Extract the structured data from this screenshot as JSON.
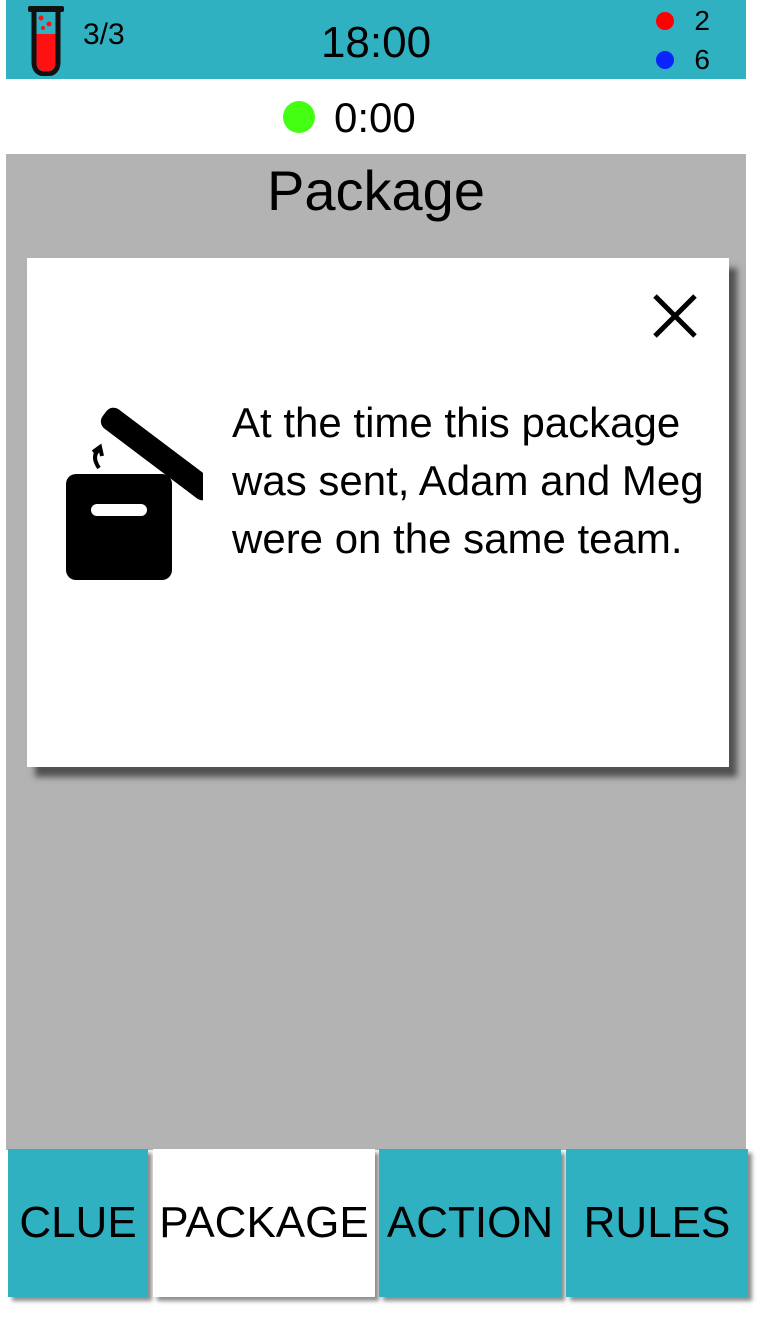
{
  "header": {
    "lives": "3/3",
    "clock": "18:00",
    "score_red": "2",
    "score_blue": "6",
    "colors": {
      "bar": "#2fb1c1",
      "red": "#ff0000",
      "blue": "#0a24ff"
    },
    "vial_icon": "test-tube-icon"
  },
  "timer": {
    "value": "0:00",
    "status_color": "#44ff11"
  },
  "page": {
    "title": "Package"
  },
  "modal": {
    "message": "At the time this package was sent, Adam and Meg were on the same team.",
    "icon": "open-box-icon",
    "close_icon": "close-icon"
  },
  "tabs": [
    {
      "label": "CLUE",
      "active": false
    },
    {
      "label": "PACKAGE",
      "active": true
    },
    {
      "label": "ACTION",
      "active": false
    },
    {
      "label": "RULES",
      "active": false
    }
  ]
}
